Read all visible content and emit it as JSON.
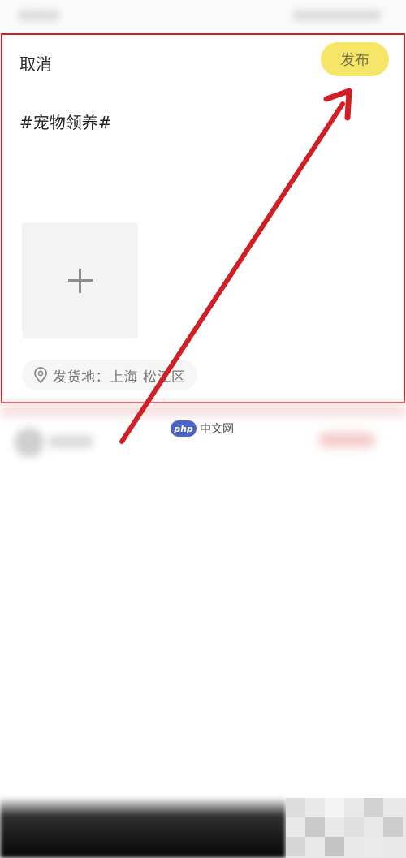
{
  "header": {
    "cancel_label": "取消",
    "publish_label": "发布"
  },
  "post": {
    "text": "#宠物领养#"
  },
  "location": {
    "label": "发货地：上海 松江区",
    "icon": "location-pin-icon"
  },
  "watermark": {
    "logo_text": "php",
    "text": "中文网"
  },
  "colors": {
    "highlight_border": "#d01f25",
    "publish_button": "#f5e66a",
    "arrow": "#d01f25"
  }
}
